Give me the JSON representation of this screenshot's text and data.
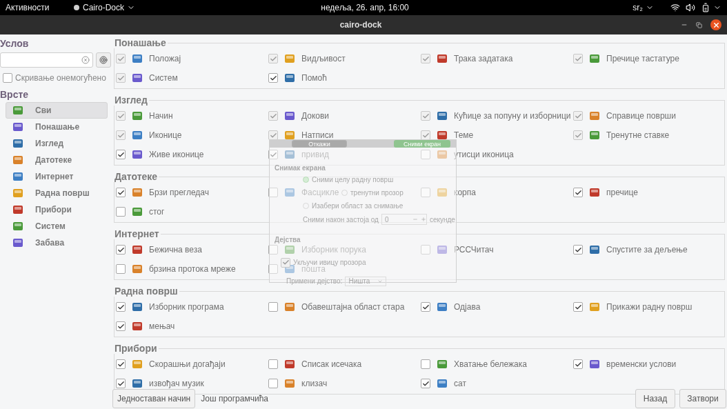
{
  "top_bar": {
    "activities": "Активности",
    "app_menu": "Cairo-Dock",
    "clock": "недеља, 26. апр, 16:00",
    "keyboard_layout": "sr₂"
  },
  "window": {
    "title": "cairo-dock"
  },
  "sidebar": {
    "filter_title": "Услов",
    "hide_disabled": {
      "label": "Скривање онемогућено",
      "checked": false
    },
    "categories_title": "Врсте",
    "categories": [
      {
        "label": "Сви",
        "selected": true
      },
      {
        "label": "Понашање",
        "selected": false
      },
      {
        "label": "Изглед",
        "selected": false
      },
      {
        "label": "Датотеке",
        "selected": false
      },
      {
        "label": "Интернет",
        "selected": false
      },
      {
        "label": "Радна површ",
        "selected": false
      },
      {
        "label": "Прибори",
        "selected": false
      },
      {
        "label": "Систем",
        "selected": false
      },
      {
        "label": "Забава",
        "selected": false
      }
    ]
  },
  "groups": [
    {
      "title": "Понашање",
      "items": [
        {
          "label": "Положај",
          "checked": true,
          "disabled": true
        },
        {
          "label": "Видљивост",
          "checked": true,
          "disabled": true
        },
        {
          "label": "Трака задатака",
          "checked": true,
          "disabled": true
        },
        {
          "label": "Пречице тастатуре",
          "checked": true,
          "disabled": true
        },
        {
          "label": "Систем",
          "checked": true,
          "disabled": true
        },
        {
          "label": "Помоћ",
          "checked": true,
          "disabled": false
        }
      ]
    },
    {
      "title": "Изглед",
      "items": [
        {
          "label": "Начин",
          "checked": true,
          "disabled": true
        },
        {
          "label": "Докови",
          "checked": true,
          "disabled": true
        },
        {
          "label": "Кућице за попуну и изборници",
          "checked": true,
          "disabled": true
        },
        {
          "label": "Справице површи",
          "checked": true,
          "disabled": true
        },
        {
          "label": "Иконице",
          "checked": true,
          "disabled": true
        },
        {
          "label": "Натписи",
          "checked": true,
          "disabled": true
        },
        {
          "label": "Теме",
          "checked": true,
          "disabled": true
        },
        {
          "label": "Тренутне ставке",
          "checked": true,
          "disabled": true
        },
        {
          "label": "Живе иконице",
          "checked": true,
          "disabled": false
        },
        {
          "label": "привид",
          "checked": true,
          "disabled": false
        },
        {
          "label": "утисци иконица",
          "checked": false,
          "disabled": false
        }
      ]
    },
    {
      "title": "Датотеке",
      "items": [
        {
          "label": "Брзи прегледач",
          "checked": true,
          "disabled": false
        },
        {
          "label": "Фасцикле",
          "checked": false,
          "disabled": false
        },
        {
          "label": "корпа",
          "checked": false,
          "disabled": false
        },
        {
          "label": "пречице",
          "checked": true,
          "disabled": false
        },
        {
          "label": "стог",
          "checked": false,
          "disabled": false
        }
      ]
    },
    {
      "title": "Интернет",
      "items": [
        {
          "label": "Бежична веза",
          "checked": true,
          "disabled": false
        },
        {
          "label": "Изборник порука",
          "checked": false,
          "disabled": false
        },
        {
          "label": "РССЧитач",
          "checked": false,
          "disabled": false
        },
        {
          "label": "Спустите за дељење",
          "checked": true,
          "disabled": false
        },
        {
          "label": "брзина протока мреже",
          "checked": false,
          "disabled": false
        },
        {
          "label": "пошта",
          "checked": false,
          "disabled": false
        }
      ]
    },
    {
      "title": "Радна површ",
      "items": [
        {
          "label": "Изборник програма",
          "checked": true,
          "disabled": false
        },
        {
          "label": "Обавештајна област стара",
          "checked": false,
          "disabled": false
        },
        {
          "label": "Одјава",
          "checked": true,
          "disabled": false
        },
        {
          "label": "Прикажи радну површ",
          "checked": true,
          "disabled": false
        },
        {
          "label": "мењач",
          "checked": true,
          "disabled": false
        }
      ]
    },
    {
      "title": "Прибори",
      "items": [
        {
          "label": "Скорашњи догађаји",
          "checked": true,
          "disabled": false
        },
        {
          "label": "Списак исечака",
          "checked": false,
          "disabled": false
        },
        {
          "label": "Хватање бележака",
          "checked": false,
          "disabled": false
        },
        {
          "label": "временски услови",
          "checked": true,
          "disabled": false
        },
        {
          "label": "извођач музик",
          "checked": true,
          "disabled": false
        },
        {
          "label": "клизач",
          "checked": false,
          "disabled": false
        },
        {
          "label": "сат",
          "checked": true,
          "disabled": false
        }
      ]
    }
  ],
  "footer": {
    "simple_mode": "Једноставан начин",
    "more_applets": "Још програмчића",
    "back": "Назад",
    "close": "Затвори"
  },
  "screenshot_dialog": {
    "cancel": "Откажи",
    "take": "Сними екран",
    "section_title": "Снимак екрана",
    "options": [
      {
        "label": "Сними целу радну површ",
        "selected": true
      },
      {
        "label": "тренутни прозор",
        "selected": false
      },
      {
        "label": "Изабери област за снимање",
        "selected": false
      }
    ],
    "delay_label": "Сними након застоја од",
    "delay_value": "0",
    "delay_unit": "секунде",
    "actions_title": "Дејства",
    "include_border": {
      "label": "Укључи ивицу прозора",
      "checked": true
    },
    "effect_label": "Примени дејство:",
    "effect_value": "Ништа"
  }
}
